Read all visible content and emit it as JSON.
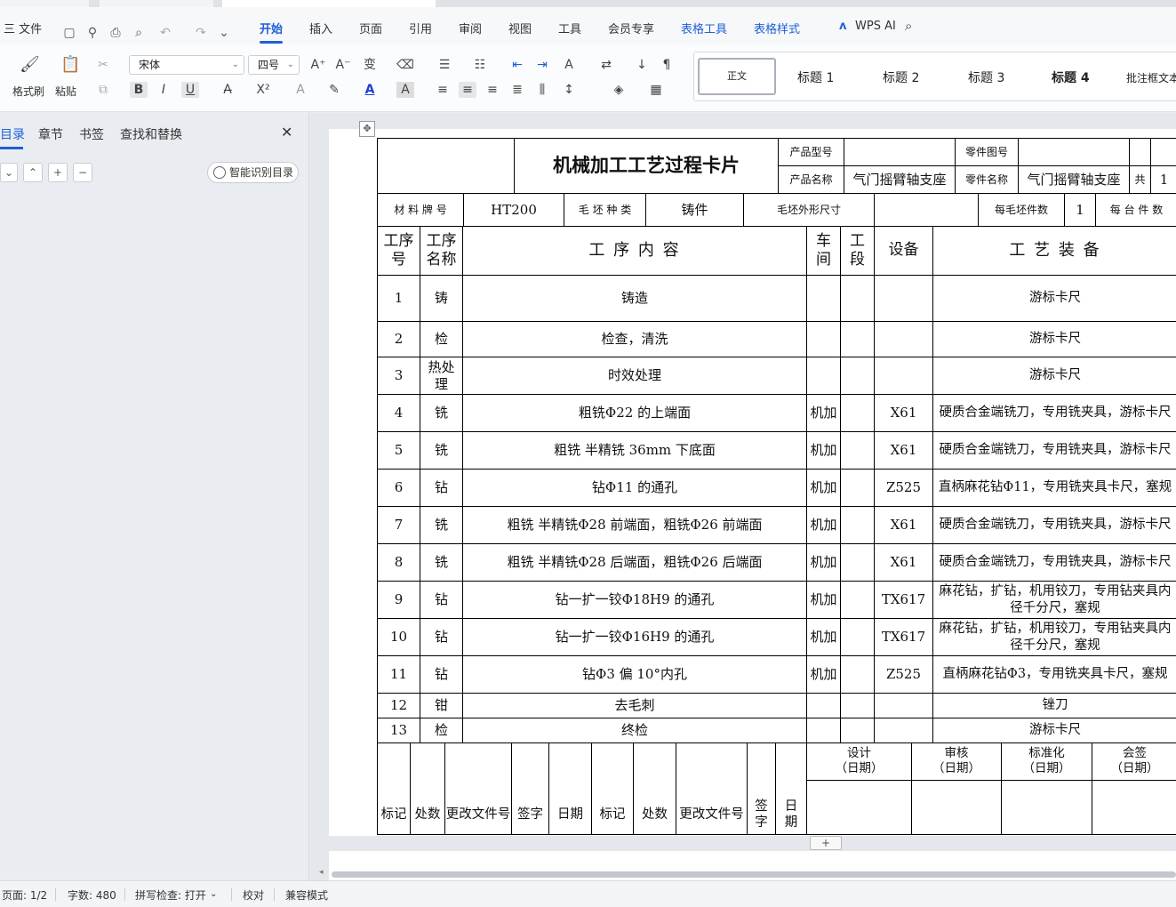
{
  "menu": {
    "app_menu": "三 文件",
    "tabs": [
      "开始",
      "插入",
      "页面",
      "引用",
      "审阅",
      "视图",
      "工具",
      "会员专享",
      "表格工具",
      "表格样式"
    ],
    "wps_ai": "WPS AI"
  },
  "ribbon": {
    "format_painter": "格式刷",
    "paste": "粘贴",
    "font_name": "宋体",
    "font_size": "四号",
    "styles": {
      "normal": "正文",
      "h1": "标题 1",
      "h2": "标题 2",
      "h3": "标题 3",
      "h4": "标题 4",
      "comment": "批注框文本"
    },
    "colors": {
      "accent": "#1f5fd6",
      "font_color": "#1f3fd6"
    }
  },
  "left_panel": {
    "tabs": [
      "目录",
      "章节",
      "书签",
      "查找和替换"
    ],
    "smart_toc": "智能识别目录"
  },
  "status": {
    "page": "页面: 1/2",
    "words": "字数: 480",
    "spell": "拼写检查: 打开",
    "proof": "校对",
    "compat": "兼容模式"
  },
  "card": {
    "title": "机械加工工艺过程卡片",
    "product_model_label": "产品型号",
    "part_drawing_label": "零件图号",
    "product_name_label": "产品名称",
    "product_name": "气门摇臂轴支座",
    "part_name_label": "零件名称",
    "part_name": "气门摇臂轴支座",
    "total_label": "共",
    "total_value": "1",
    "material_label": "材 料 牌 号",
    "material": "HT200",
    "blank_type_label": "毛 坯 种 类",
    "blank_type": "铸件",
    "blank_size_label": "毛坯外形尺寸",
    "blanks_per_label": "每毛坯件数",
    "blanks_per": "1",
    "per_unit_label": "每 台 件 数",
    "col_op_no": "工序号",
    "col_op_name": "工序名称",
    "col_content": "工 序 内 容",
    "col_workshop": "车间",
    "col_section": "工段",
    "col_equipment": "设备",
    "col_tooling": "工 艺 装 备",
    "rows": [
      {
        "no": "1",
        "name": "铸",
        "content": "铸造",
        "shop": "",
        "equip": "",
        "tool": "游标卡尺"
      },
      {
        "no": "2",
        "name": "检",
        "content": "检查，清洗",
        "shop": "",
        "equip": "",
        "tool": "游标卡尺"
      },
      {
        "no": "3",
        "name": "热处理",
        "content": "时效处理",
        "shop": "",
        "equip": "",
        "tool": "游标卡尺"
      },
      {
        "no": "4",
        "name": "铣",
        "content": "粗铣Φ22 的上端面",
        "shop": "机加",
        "equip": "X61",
        "tool": "硬质合金端铣刀，专用铣夹具，游标卡尺"
      },
      {
        "no": "5",
        "name": "铣",
        "content": "粗铣  半精铣 36mm 下底面",
        "shop": "机加",
        "equip": "X61",
        "tool": "硬质合金端铣刀，专用铣夹具，游标卡尺"
      },
      {
        "no": "6",
        "name": "钻",
        "content": "钻Φ11 的通孔",
        "shop": "机加",
        "equip": "Z525",
        "tool": "直柄麻花钻Φ11，专用铣夹具卡尺，塞规"
      },
      {
        "no": "7",
        "name": "铣",
        "content": "粗铣  半精铣Φ28 前端面，粗铣Φ26 前端面",
        "shop": "机加",
        "equip": "X61",
        "tool": "硬质合金端铣刀，专用铣夹具，游标卡尺"
      },
      {
        "no": "8",
        "name": "铣",
        "content": "粗铣  半精铣Φ28 后端面，粗铣Φ26 后端面",
        "shop": "机加",
        "equip": "X61",
        "tool": "硬质合金端铣刀，专用铣夹具，游标卡尺"
      },
      {
        "no": "9",
        "name": "钻",
        "content": "钻一扩一铰Φ18H9 的通孔",
        "shop": "机加",
        "equip": "TX617",
        "tool": "麻花钻，扩钻，机用铰刀，专用钻夹具内径千分尺，塞规"
      },
      {
        "no": "10",
        "name": "钻",
        "content": "钻一扩一铰Φ16H9 的通孔",
        "shop": "机加",
        "equip": "TX617",
        "tool": "麻花钻，扩钻，机用铰刀，专用钻夹具内径千分尺，塞规"
      },
      {
        "no": "11",
        "name": "钻",
        "content": "钻Φ3 偏 10°内孔",
        "shop": "机加",
        "equip": "Z525",
        "tool": "直柄麻花钻Φ3，专用铣夹具卡尺，塞规"
      },
      {
        "no": "12",
        "name": "钳",
        "content": "去毛刺",
        "shop": "",
        "equip": "",
        "tool": "锉刀"
      },
      {
        "no": "13",
        "name": "检",
        "content": "终检",
        "shop": "",
        "equip": "",
        "tool": "游标卡尺"
      }
    ],
    "sign_labels": [
      "设计\n（日期）",
      "审核\n（日期）",
      "标准化\n（日期）",
      "会签\n（日期）"
    ],
    "footer_labels": [
      "标记",
      "处数",
      "更改文件号",
      "签字",
      "日期",
      "标记",
      "处数",
      "更改文件号",
      "签字",
      "日期"
    ]
  }
}
